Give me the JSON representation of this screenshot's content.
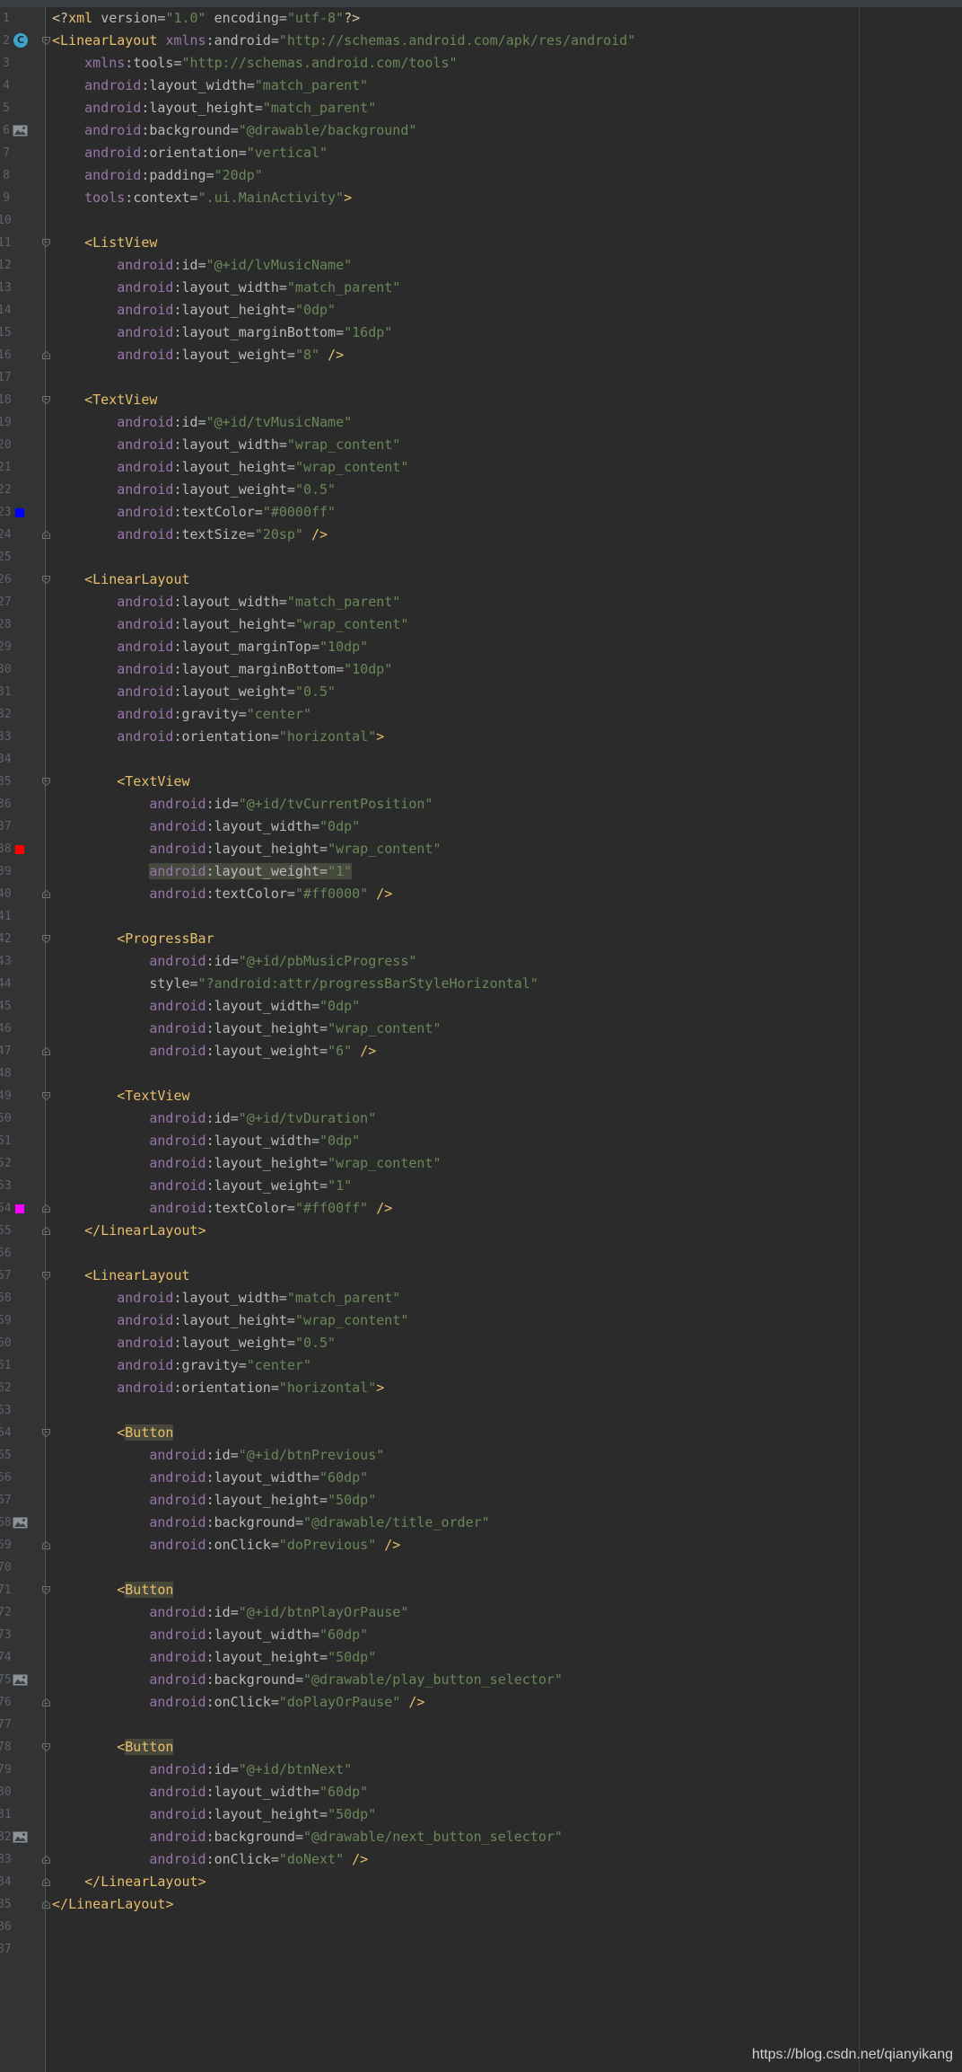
{
  "window": {
    "app": "Android Studio",
    "file_type": "XML layout"
  },
  "colors": {
    "editor_background": "#2b2b2b",
    "gutter_background": "#313335",
    "tag": "#e8bf6a",
    "namespace": "#9876aa",
    "attribute": "#bababa",
    "value": "#6a8759",
    "line_number": "#606366"
  },
  "gutter_markers": {
    "line_2": {
      "type": "class-icon",
      "glyph": "C"
    },
    "line_6": {
      "type": "image-icon"
    },
    "line_23": {
      "type": "color-swatch",
      "color": "#0000ff"
    },
    "line_38": {
      "type": "color-swatch",
      "color": "#ff0000"
    },
    "line_54": {
      "type": "color-swatch",
      "color": "#ff00ff"
    },
    "line_68": {
      "type": "image-icon"
    },
    "line_75": {
      "type": "image-icon"
    },
    "line_82": {
      "type": "image-icon"
    }
  },
  "lines": [
    {
      "n": "1",
      "text": "<?xml version=\"1.0\" encoding=\"utf-8\"?>"
    },
    {
      "n": "2",
      "text": "<LinearLayout xmlns:android=\"http://schemas.android.com/apk/res/android\""
    },
    {
      "n": "3",
      "text": "    xmlns:tools=\"http://schemas.android.com/tools\""
    },
    {
      "n": "4",
      "text": "    android:layout_width=\"match_parent\""
    },
    {
      "n": "5",
      "text": "    android:layout_height=\"match_parent\""
    },
    {
      "n": "6",
      "text": "    android:background=\"@drawable/background\""
    },
    {
      "n": "7",
      "text": "    android:orientation=\"vertical\""
    },
    {
      "n": "8",
      "text": "    android:padding=\"20dp\""
    },
    {
      "n": "9",
      "text": "    tools:context=\".ui.MainActivity\">"
    },
    {
      "n": "10",
      "text": ""
    },
    {
      "n": "11",
      "text": "    <ListView"
    },
    {
      "n": "12",
      "text": "        android:id=\"@+id/lvMusicName\""
    },
    {
      "n": "13",
      "text": "        android:layout_width=\"match_parent\""
    },
    {
      "n": "14",
      "text": "        android:layout_height=\"0dp\""
    },
    {
      "n": "15",
      "text": "        android:layout_marginBottom=\"16dp\""
    },
    {
      "n": "16",
      "text": "        android:layout_weight=\"8\" />"
    },
    {
      "n": "17",
      "text": ""
    },
    {
      "n": "18",
      "text": "    <TextView"
    },
    {
      "n": "19",
      "text": "        android:id=\"@+id/tvMusicName\""
    },
    {
      "n": "20",
      "text": "        android:layout_width=\"wrap_content\""
    },
    {
      "n": "21",
      "text": "        android:layout_height=\"wrap_content\""
    },
    {
      "n": "22",
      "text": "        android:layout_weight=\"0.5\""
    },
    {
      "n": "23",
      "text": "        android:textColor=\"#0000ff\""
    },
    {
      "n": "24",
      "text": "        android:textSize=\"20sp\" />"
    },
    {
      "n": "25",
      "text": ""
    },
    {
      "n": "26",
      "text": "    <LinearLayout"
    },
    {
      "n": "27",
      "text": "        android:layout_width=\"match_parent\""
    },
    {
      "n": "28",
      "text": "        android:layout_height=\"wrap_content\""
    },
    {
      "n": "29",
      "text": "        android:layout_marginTop=\"10dp\""
    },
    {
      "n": "30",
      "text": "        android:layout_marginBottom=\"10dp\""
    },
    {
      "n": "31",
      "text": "        android:layout_weight=\"0.5\""
    },
    {
      "n": "32",
      "text": "        android:gravity=\"center\""
    },
    {
      "n": "33",
      "text": "        android:orientation=\"horizontal\">"
    },
    {
      "n": "34",
      "text": ""
    },
    {
      "n": "35",
      "text": "        <TextView"
    },
    {
      "n": "36",
      "text": "            android:id=\"@+id/tvCurrentPosition\""
    },
    {
      "n": "37",
      "text": "            android:layout_width=\"0dp\""
    },
    {
      "n": "38",
      "text": "            android:layout_height=\"wrap_content\""
    },
    {
      "n": "39",
      "text": "            android:layout_weight=\"1\""
    },
    {
      "n": "40",
      "text": "            android:textColor=\"#ff0000\" />"
    },
    {
      "n": "41",
      "text": ""
    },
    {
      "n": "42",
      "text": "        <ProgressBar"
    },
    {
      "n": "43",
      "text": "            android:id=\"@+id/pbMusicProgress\""
    },
    {
      "n": "44",
      "text": "            style=\"?android:attr/progressBarStyleHorizontal\""
    },
    {
      "n": "45",
      "text": "            android:layout_width=\"0dp\""
    },
    {
      "n": "46",
      "text": "            android:layout_height=\"wrap_content\""
    },
    {
      "n": "47",
      "text": "            android:layout_weight=\"6\" />"
    },
    {
      "n": "48",
      "text": ""
    },
    {
      "n": "49",
      "text": "        <TextView"
    },
    {
      "n": "50",
      "text": "            android:id=\"@+id/tvDuration\""
    },
    {
      "n": "51",
      "text": "            android:layout_width=\"0dp\""
    },
    {
      "n": "52",
      "text": "            android:layout_height=\"wrap_content\""
    },
    {
      "n": "53",
      "text": "            android:layout_weight=\"1\""
    },
    {
      "n": "54",
      "text": "            android:textColor=\"#ff00ff\" />"
    },
    {
      "n": "55",
      "text": "    </LinearLayout>"
    },
    {
      "n": "56",
      "text": ""
    },
    {
      "n": "57",
      "text": "    <LinearLayout"
    },
    {
      "n": "58",
      "text": "        android:layout_width=\"match_parent\""
    },
    {
      "n": "59",
      "text": "        android:layout_height=\"wrap_content\""
    },
    {
      "n": "60",
      "text": "        android:layout_weight=\"0.5\""
    },
    {
      "n": "61",
      "text": "        android:gravity=\"center\""
    },
    {
      "n": "62",
      "text": "        android:orientation=\"horizontal\">"
    },
    {
      "n": "63",
      "text": ""
    },
    {
      "n": "64",
      "text": "        <Button"
    },
    {
      "n": "65",
      "text": "            android:id=\"@+id/btnPrevious\""
    },
    {
      "n": "66",
      "text": "            android:layout_width=\"60dp\""
    },
    {
      "n": "67",
      "text": "            android:layout_height=\"50dp\""
    },
    {
      "n": "68",
      "text": "            android:background=\"@drawable/title_order\""
    },
    {
      "n": "69",
      "text": "            android:onClick=\"doPrevious\" />"
    },
    {
      "n": "70",
      "text": ""
    },
    {
      "n": "71",
      "text": "        <Button"
    },
    {
      "n": "72",
      "text": "            android:id=\"@+id/btnPlayOrPause\""
    },
    {
      "n": "73",
      "text": "            android:layout_width=\"60dp\""
    },
    {
      "n": "74",
      "text": "            android:layout_height=\"50dp\""
    },
    {
      "n": "75",
      "text": "            android:background=\"@drawable/play_button_selector\""
    },
    {
      "n": "76",
      "text": "            android:onClick=\"doPlayOrPause\" />"
    },
    {
      "n": "77",
      "text": ""
    },
    {
      "n": "78",
      "text": "        <Button"
    },
    {
      "n": "79",
      "text": "            android:id=\"@+id/btnNext\""
    },
    {
      "n": "80",
      "text": "            android:layout_width=\"60dp\""
    },
    {
      "n": "81",
      "text": "            android:layout_height=\"50dp\""
    },
    {
      "n": "82",
      "text": "            android:background=\"@drawable/next_button_selector\""
    },
    {
      "n": "83",
      "text": "            android:onClick=\"doNext\" />"
    },
    {
      "n": "84",
      "text": "    </LinearLayout>"
    },
    {
      "n": "85",
      "text": "</LinearLayout>"
    },
    {
      "n": "86",
      "text": ""
    },
    {
      "n": "87",
      "text": ""
    }
  ],
  "watermark": "https://blog.csdn.net/qianyikang"
}
